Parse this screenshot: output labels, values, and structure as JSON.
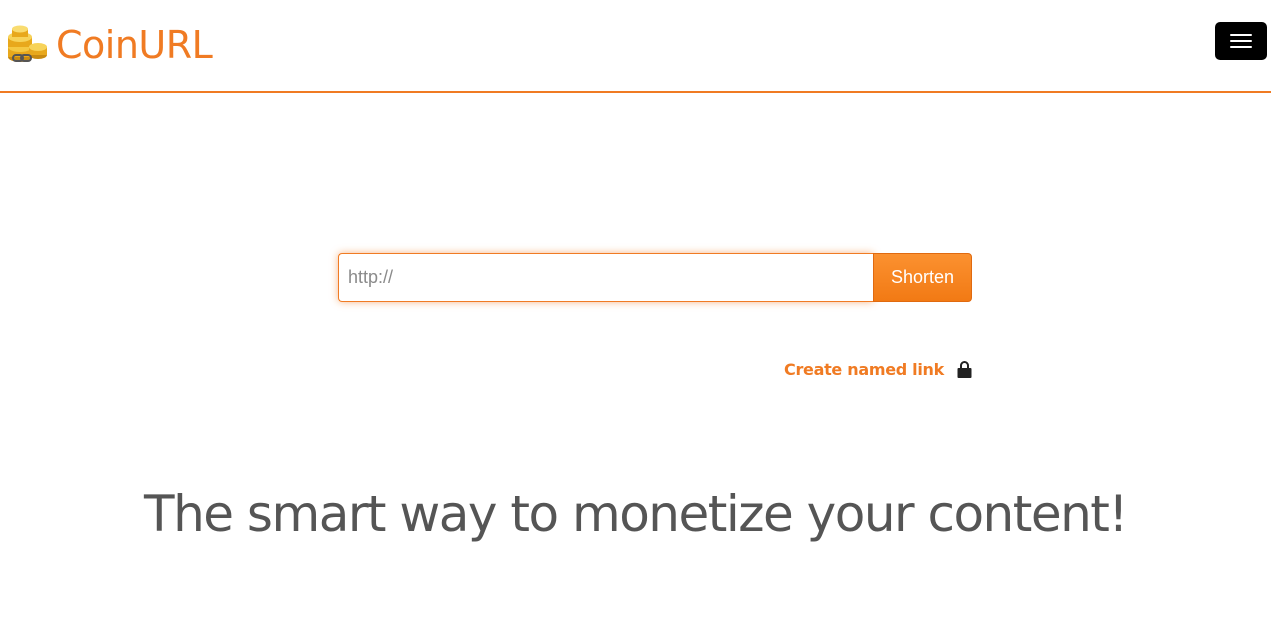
{
  "header": {
    "brand_name": "CoinURL",
    "logo_icon": "coin-stack-link-icon",
    "menu_icon": "hamburger-menu-icon"
  },
  "shorten": {
    "placeholder": "http://",
    "value": "",
    "button_label": "Shorten"
  },
  "named_link": {
    "label": "Create named link",
    "icon": "lock-icon"
  },
  "tagline": "The smart way to monetize your content!",
  "colors": {
    "accent": "#f07b23",
    "button_top": "#fb9130",
    "button_bottom": "#f27a14",
    "text": "#555555",
    "menu_button": "#000000"
  }
}
